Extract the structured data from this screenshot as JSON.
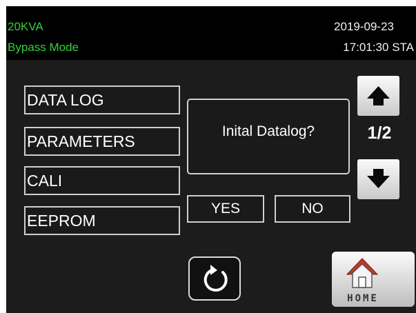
{
  "status_bar": {
    "model": "20KVA",
    "mode": "Bypass Mode",
    "date": "2019-09-23",
    "time": "17:01:30 STA"
  },
  "menu": {
    "items": [
      {
        "label": "DATA LOG"
      },
      {
        "label": "PARAMETERS"
      },
      {
        "label": "CALI"
      },
      {
        "label": "EEPROM"
      }
    ]
  },
  "dialog": {
    "message": "Inital Datalog?",
    "yes_label": "YES",
    "no_label": "NO"
  },
  "pager": {
    "indicator": "1/2",
    "up_icon": "arrow-up-icon",
    "down_icon": "arrow-down-icon"
  },
  "footer": {
    "back_icon": "refresh-back-icon",
    "home_label": "HOME",
    "home_icon": "house-icon"
  },
  "colors": {
    "status_text_green": "#33d23a",
    "screen_background": "#1c1c1c",
    "roof_red": "#c0392b"
  }
}
